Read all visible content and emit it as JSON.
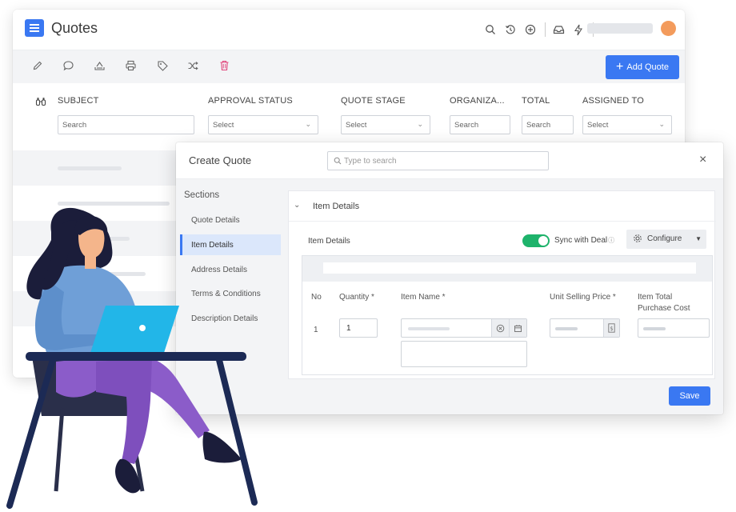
{
  "app": {
    "title": "Quotes",
    "menu_icon": "hamburger-menu-icon",
    "top_icons": [
      "search-icon",
      "history-icon",
      "add-circle-icon",
      "inbox-icon",
      "lightning-icon"
    ],
    "avatar_color": "#f39b5c"
  },
  "toolbar": {
    "icons": [
      "edit-icon",
      "comment-icon",
      "upload-icon",
      "print-icon",
      "tag-icon",
      "shuffle-icon",
      "delete-icon"
    ],
    "add_button": "Add Quote"
  },
  "list": {
    "columns": [
      {
        "label": "SUBJECT",
        "filter": "Search",
        "type": "input"
      },
      {
        "label": "APPROVAL STATUS",
        "filter": "Select",
        "type": "select"
      },
      {
        "label": "QUOTE STAGE",
        "filter": "Select",
        "type": "select"
      },
      {
        "label": "ORGANIZA...",
        "filter": "Search",
        "type": "input"
      },
      {
        "label": "TOTAL",
        "filter": "Search",
        "type": "input"
      },
      {
        "label": "ASSIGNED TO",
        "filter": "Select",
        "type": "select"
      }
    ]
  },
  "dialog": {
    "title": "Create Quote",
    "search_placeholder": "Type to search",
    "sections_title": "Sections",
    "sections": [
      "Quote Details",
      "Item Details",
      "Address Details",
      "Terms & Conditions",
      "Description Details"
    ],
    "active_section": "Item Details",
    "panel_title": "Item Details",
    "sub_label": "Item Details",
    "sync_label": "Sync with Deal",
    "sync_on": true,
    "configure_label": "Configure",
    "table": {
      "headers": {
        "no": "No",
        "quantity": "Quantity *",
        "item_name": "Item Name *",
        "unit_price": "Unit Selling Price *",
        "cost_line1": "Item Total",
        "cost_line2": "Purchase Cost"
      },
      "row": {
        "no": "1",
        "quantity": "1"
      }
    },
    "save_label": "Save"
  },
  "colors": {
    "primary": "#3a78f2",
    "toggle_on": "#1eb36b",
    "delete": "#e0457b"
  }
}
